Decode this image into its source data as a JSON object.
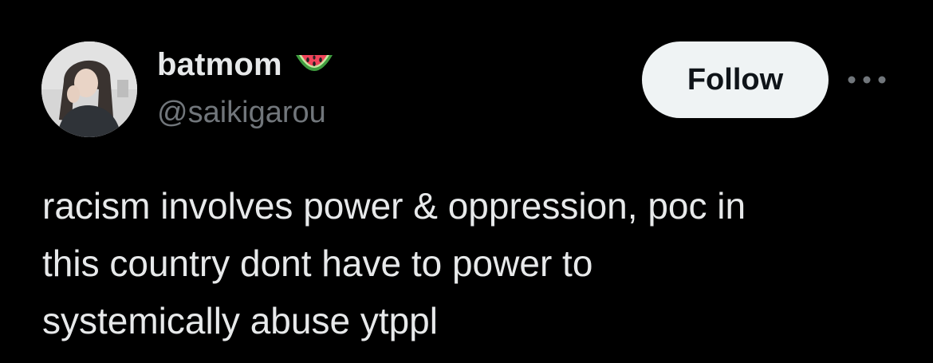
{
  "author": {
    "display_name": "batmom",
    "handle": "@saikigarou",
    "name_emoji_icon": "watermelon-icon",
    "avatar_icon": "user-avatar"
  },
  "actions": {
    "follow_label": "Follow",
    "more_icon": "more-horizontal-icon"
  },
  "tweet": {
    "text": "racism involves power & oppression, poc in\nthis country dont have to power to\nsystemically abuse ytppl"
  },
  "colors": {
    "background": "#000000",
    "text_primary": "#e7e9ea",
    "text_secondary": "#71767b",
    "follow_button_bg": "#eff3f4",
    "follow_button_text": "#0f1419"
  }
}
